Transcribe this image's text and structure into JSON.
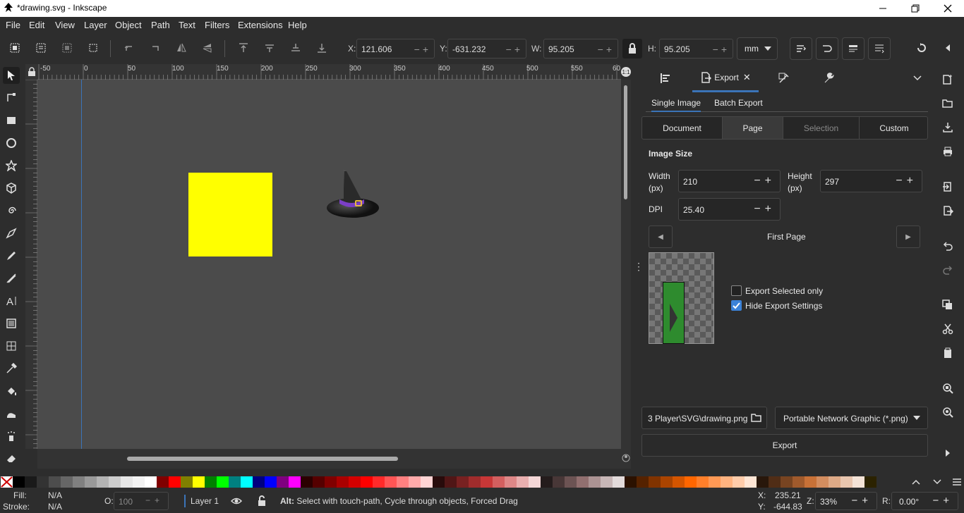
{
  "window": {
    "title": "*drawing.svg - Inkscape"
  },
  "menu": [
    "File",
    "Edit",
    "View",
    "Layer",
    "Object",
    "Path",
    "Text",
    "Filters",
    "Extensions",
    "Help"
  ],
  "toolbar": {
    "x_label": "X:",
    "x_value": "121.606",
    "y_label": "Y:",
    "y_value": "-631.232",
    "w_label": "W:",
    "w_value": "95.205",
    "h_label": "H:",
    "h_value": "95.205",
    "unit": "mm"
  },
  "ruler": {
    "h_ticks": [
      "-50",
      "0",
      "50",
      "100",
      "150",
      "200",
      "250",
      "300",
      "350",
      "400",
      "450",
      "500",
      "550",
      "60"
    ]
  },
  "panel": {
    "export_tab_label": "Export",
    "subtabs": [
      "Single Image",
      "Batch Export"
    ],
    "areas": [
      "Document",
      "Page",
      "Selection",
      "Custom"
    ],
    "image_size_label": "Image Size",
    "width_label": "Width\n(px)",
    "width_value": "210",
    "height_label": "Height\n(px)",
    "height_value": "297",
    "dpi_label": "DPI",
    "dpi_value": "25.40",
    "page_name": "First Page",
    "export_selected_only": "Export Selected only",
    "hide_export_settings": "Hide Export Settings",
    "filename": "3 Player\\SVG\\drawing.png",
    "filetype": "Portable Network Graphic (*.png)",
    "export_button": "Export"
  },
  "status": {
    "fill_label": "Fill:",
    "fill_value": "N/A",
    "stroke_label": "Stroke:",
    "stroke_value": "N/A",
    "opacity_label": "O:",
    "opacity_value": "100",
    "layer": "Layer 1",
    "message": "Alt: Select with touch-path, Cycle through objects, Forced Drag",
    "x_label": "X:",
    "x_value": "235.21",
    "y_label": "Y:",
    "y_value": "-644.83",
    "zoom_label": "Z:",
    "zoom_value": "33%",
    "rot_label": "R:",
    "rot_value": "0.00°"
  },
  "palette": [
    "#000000",
    "#1a1a1a",
    "#333333",
    "#4d4d4d",
    "#666666",
    "#808080",
    "#999999",
    "#b3b3b3",
    "#cccccc",
    "#e6e6e6",
    "#f2f2f2",
    "#ffffff",
    "#800000",
    "#ff0000",
    "#808000",
    "#ffff00",
    "#008000",
    "#00ff00",
    "#008080",
    "#00ffff",
    "#000080",
    "#0000ff",
    "#800080",
    "#ff00ff",
    "#2b0000",
    "#550000",
    "#800000",
    "#aa0000",
    "#d40000",
    "#ff0000",
    "#ff2a2a",
    "#ff5555",
    "#ff8080",
    "#ffaaaa",
    "#ffd5d5",
    "#280b0b",
    "#501616",
    "#782121",
    "#a02c2c",
    "#c83737",
    "#d35f5f",
    "#de8787",
    "#e9afaf",
    "#f4d7d7",
    "#241c1c",
    "#483737",
    "#6c5353",
    "#916f6f",
    "#ac9393",
    "#c8b7b7",
    "#e3dbdb",
    "#2b1100",
    "#552200",
    "#803300",
    "#aa4400",
    "#d45500",
    "#ff6600",
    "#ff7f2a",
    "#ff9955",
    "#ffb380",
    "#ffccaa",
    "#ffe6d5",
    "#28170b",
    "#502d16",
    "#784421",
    "#a05a2c",
    "#c87137",
    "#d38d5f",
    "#deaa87",
    "#e9c6af",
    "#f4e3d7",
    "#2b2200"
  ]
}
